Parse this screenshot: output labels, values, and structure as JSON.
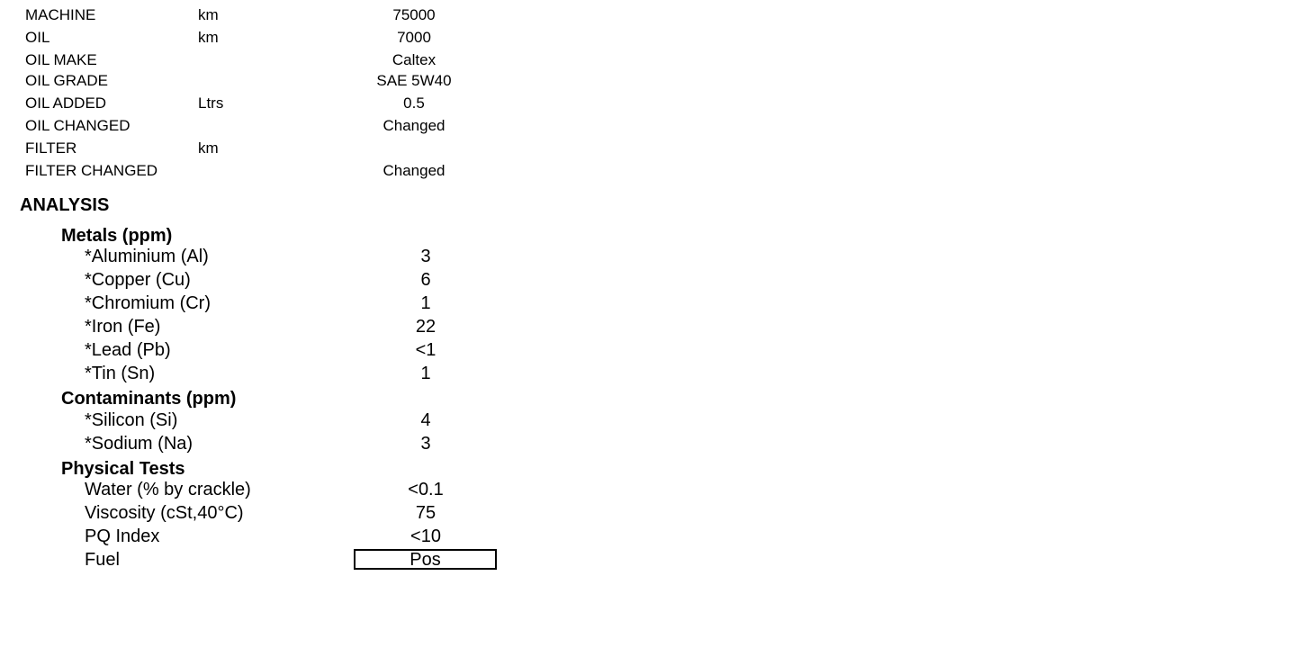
{
  "service": [
    {
      "label": "MACHINE",
      "unit": "km",
      "value": "75000"
    },
    {
      "label": "OIL",
      "unit": "km",
      "value": "7000"
    },
    {
      "label": "OIL MAKE",
      "unit": "",
      "value": "Caltex"
    },
    {
      "label": "OIL GRADE",
      "unit": "",
      "value": "SAE 5W40"
    },
    {
      "label": "OIL ADDED",
      "unit": "Ltrs",
      "value": "0.5"
    },
    {
      "label": "OIL CHANGED",
      "unit": "",
      "value": "Changed"
    },
    {
      "label": "FILTER",
      "unit": "km",
      "value": ""
    },
    {
      "label": "FILTER CHANGED",
      "unit": "",
      "value": "Changed"
    }
  ],
  "analysis": {
    "title": "ANALYSIS",
    "metals": {
      "title": "Metals (ppm)",
      "rows": [
        {
          "label": "*Aluminium (Al)",
          "value": "3"
        },
        {
          "label": "*Copper (Cu)",
          "value": "6"
        },
        {
          "label": "*Chromium (Cr)",
          "value": "1"
        },
        {
          "label": "*Iron (Fe)",
          "value": "22"
        },
        {
          "label": "*Lead (Pb)",
          "value": "<1"
        },
        {
          "label": "*Tin (Sn)",
          "value": "1"
        }
      ]
    },
    "contaminants": {
      "title": "Contaminants (ppm)",
      "rows": [
        {
          "label": "*Silicon (Si)",
          "value": "4"
        },
        {
          "label": "*Sodium (Na)",
          "value": "3"
        }
      ]
    },
    "physical": {
      "title": "Physical Tests",
      "rows": [
        {
          "label": "Water (% by crackle)",
          "value": "<0.1"
        },
        {
          "label": "Viscosity (cSt,40°C)",
          "value": "75"
        },
        {
          "label": "PQ Index",
          "value": "<10"
        },
        {
          "label": "Fuel",
          "value": "Pos"
        }
      ]
    }
  }
}
